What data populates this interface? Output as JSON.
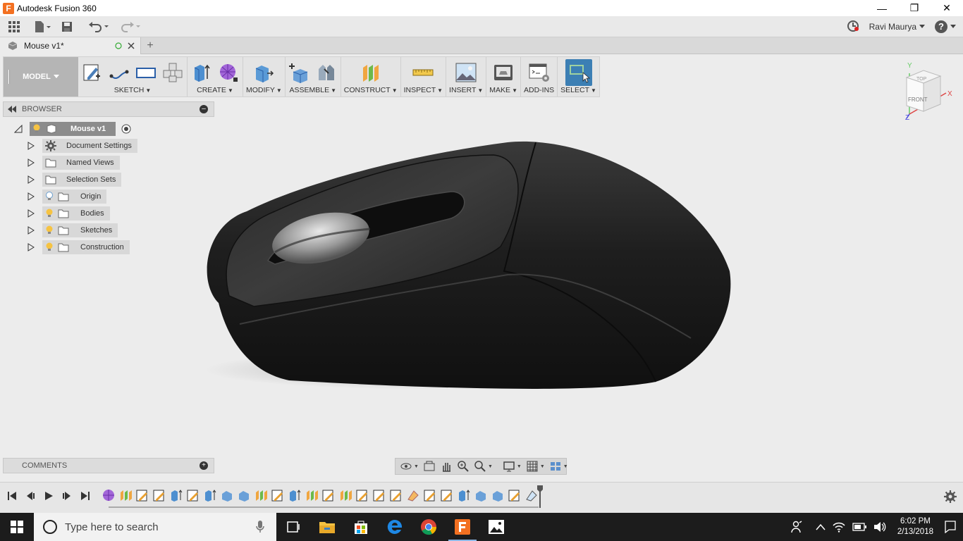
{
  "window": {
    "title": "Autodesk Fusion 360",
    "app_logo_letter": "F",
    "minimize": "—",
    "restore": "❐",
    "close": "✕"
  },
  "quick_access": {
    "user_name": "Ravi Maurya",
    "help_label": "?"
  },
  "tabs": {
    "document_tab": "Mouse v1*",
    "new_tab": "+"
  },
  "toolbar": {
    "workspace": "MODEL",
    "groups": {
      "sketch": "SKETCH",
      "create": "CREATE",
      "modify": "MODIFY",
      "assemble": "ASSEMBLE",
      "construct": "CONSTRUCT",
      "inspect": "INSPECT",
      "insert": "INSERT",
      "make": "MAKE",
      "addins": "ADD-INS",
      "select": "SELECT"
    }
  },
  "viewcube": {
    "top": "TOP",
    "front": "FRONT",
    "axis_x": "X",
    "axis_y": "Y",
    "axis_z": "Z"
  },
  "browser": {
    "title": "BROWSER",
    "root": "Mouse v1",
    "items": [
      {
        "label": "Document Settings"
      },
      {
        "label": "Named Views"
      },
      {
        "label": "Selection Sets"
      },
      {
        "label": "Origin"
      },
      {
        "label": "Bodies"
      },
      {
        "label": "Sketches"
      },
      {
        "label": "Construction"
      }
    ]
  },
  "comments": {
    "title": "COMMENTS"
  },
  "taskbar": {
    "search_placeholder": "Type here to search",
    "time": "6:02 PM",
    "date": "2/13/2018"
  },
  "colors": {
    "accent_blue": "#3c7fb4",
    "fusion_orange": "#f37021",
    "bulb_yellow": "#f6c342"
  }
}
